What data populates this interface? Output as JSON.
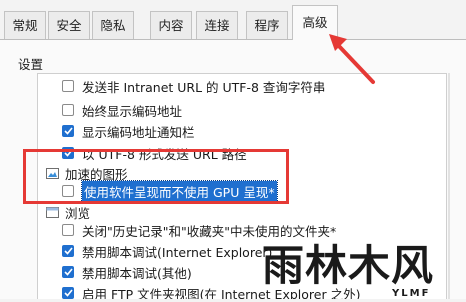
{
  "tabs": [
    {
      "label": "常规"
    },
    {
      "label": "安全"
    },
    {
      "label": "隐私"
    },
    {
      "label": "内容"
    },
    {
      "label": "连接"
    },
    {
      "label": "程序"
    },
    {
      "label": "高级"
    }
  ],
  "active_tab": "高级",
  "section_label": "设置",
  "settings": {
    "items": [
      {
        "label": "发送非 Intranet URL 的 UTF-8 查询字符串",
        "checked": false
      },
      {
        "label": "始终显示编码地址",
        "checked": false
      },
      {
        "label": "显示编码地址通知栏",
        "checked": true
      },
      {
        "label": "以 UTF-8 形式发送 URL 路径",
        "checked": true
      },
      {
        "label": "加速的图形",
        "type": "group"
      },
      {
        "label": "使用软件呈现而不使用 GPU 呈现*",
        "checked": false,
        "selected": true
      },
      {
        "label": "浏览",
        "type": "group"
      },
      {
        "label": "关闭\"历史记录\"和\"收藏夹\"中未使用的文件夹*",
        "checked": false
      },
      {
        "label": "禁用脚本调试(Internet Explorer)",
        "checked": true
      },
      {
        "label": "禁用脚本调试(其他)",
        "checked": true
      },
      {
        "label": "启用 FTP 文件夹视图(在 Internet Explorer 之外)",
        "checked": true
      }
    ]
  },
  "watermark": {
    "text": "雨林木风",
    "subtext": "YLMF"
  },
  "colors": {
    "highlight": "#e53935",
    "accent": "#1f6fcf"
  }
}
